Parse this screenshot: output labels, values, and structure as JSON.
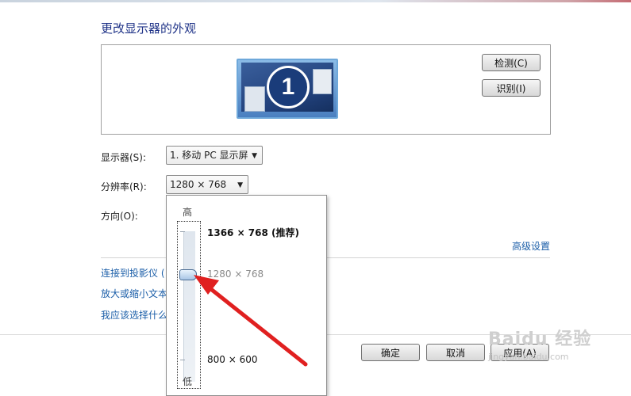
{
  "title": "更改显示器的外观",
  "buttons": {
    "detect": "检测(C)",
    "identify": "识别(I)",
    "ok": "确定",
    "cancel": "取消",
    "apply": "应用(A)"
  },
  "monitor_badge": "1",
  "fields": {
    "display_label": "显示器(S):",
    "display_value": "1. 移动 PC 显示屏",
    "resolution_label": "分辨率(R):",
    "resolution_value": "1280 × 768",
    "orientation_label": "方向(O):"
  },
  "links": {
    "advanced": "高级设置",
    "projector": "连接到投影仪 (",
    "text_size": "放大或缩小文本",
    "which_settings": "我应该选择什么"
  },
  "resolution_dropdown": {
    "high_label": "高",
    "low_label": "低",
    "options": [
      {
        "label": "1366 × 768 (推荐)",
        "recommended": true
      },
      {
        "label": "1280 × 768",
        "selected": true
      },
      {
        "label": "800 × 600"
      }
    ],
    "slider_value": "1280 × 768"
  },
  "watermark": {
    "brand": "Baidu 经验",
    "url": "jingyan.baidu.com"
  },
  "colors": {
    "title": "#1e3287",
    "link": "#1b5ea8",
    "annotation_arrow": "#e02020"
  }
}
